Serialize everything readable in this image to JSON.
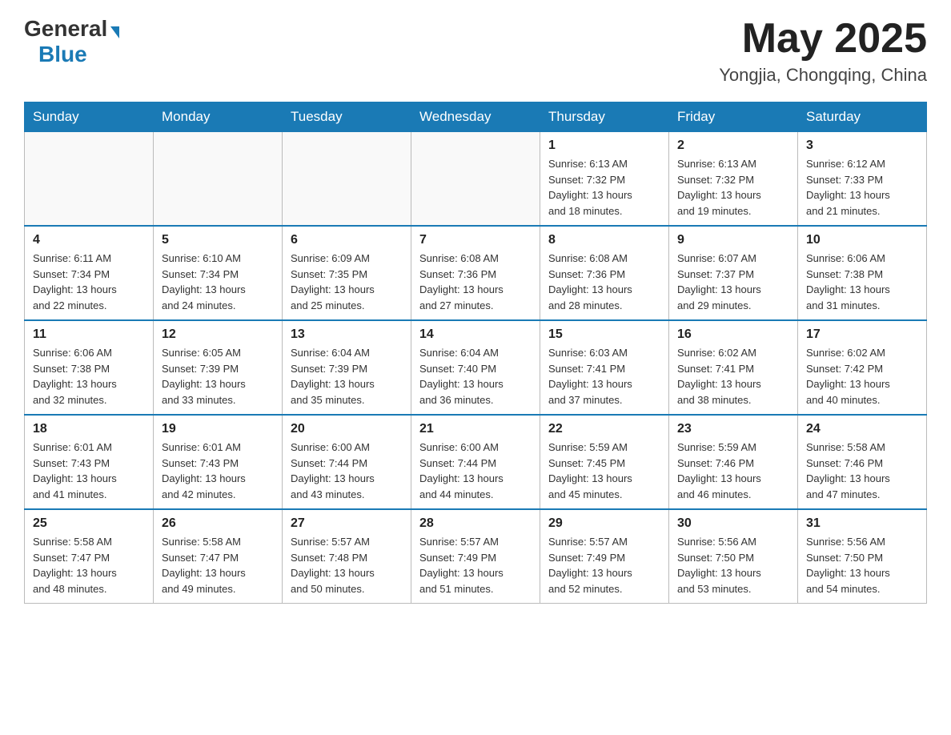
{
  "header": {
    "logo_general": "General",
    "logo_blue": "Blue",
    "month": "May 2025",
    "location": "Yongjia, Chongqing, China"
  },
  "days_of_week": [
    "Sunday",
    "Monday",
    "Tuesday",
    "Wednesday",
    "Thursday",
    "Friday",
    "Saturday"
  ],
  "weeks": [
    [
      {
        "day": "",
        "info": ""
      },
      {
        "day": "",
        "info": ""
      },
      {
        "day": "",
        "info": ""
      },
      {
        "day": "",
        "info": ""
      },
      {
        "day": "1",
        "info": "Sunrise: 6:13 AM\nSunset: 7:32 PM\nDaylight: 13 hours\nand 18 minutes."
      },
      {
        "day": "2",
        "info": "Sunrise: 6:13 AM\nSunset: 7:32 PM\nDaylight: 13 hours\nand 19 minutes."
      },
      {
        "day": "3",
        "info": "Sunrise: 6:12 AM\nSunset: 7:33 PM\nDaylight: 13 hours\nand 21 minutes."
      }
    ],
    [
      {
        "day": "4",
        "info": "Sunrise: 6:11 AM\nSunset: 7:34 PM\nDaylight: 13 hours\nand 22 minutes."
      },
      {
        "day": "5",
        "info": "Sunrise: 6:10 AM\nSunset: 7:34 PM\nDaylight: 13 hours\nand 24 minutes."
      },
      {
        "day": "6",
        "info": "Sunrise: 6:09 AM\nSunset: 7:35 PM\nDaylight: 13 hours\nand 25 minutes."
      },
      {
        "day": "7",
        "info": "Sunrise: 6:08 AM\nSunset: 7:36 PM\nDaylight: 13 hours\nand 27 minutes."
      },
      {
        "day": "8",
        "info": "Sunrise: 6:08 AM\nSunset: 7:36 PM\nDaylight: 13 hours\nand 28 minutes."
      },
      {
        "day": "9",
        "info": "Sunrise: 6:07 AM\nSunset: 7:37 PM\nDaylight: 13 hours\nand 29 minutes."
      },
      {
        "day": "10",
        "info": "Sunrise: 6:06 AM\nSunset: 7:38 PM\nDaylight: 13 hours\nand 31 minutes."
      }
    ],
    [
      {
        "day": "11",
        "info": "Sunrise: 6:06 AM\nSunset: 7:38 PM\nDaylight: 13 hours\nand 32 minutes."
      },
      {
        "day": "12",
        "info": "Sunrise: 6:05 AM\nSunset: 7:39 PM\nDaylight: 13 hours\nand 33 minutes."
      },
      {
        "day": "13",
        "info": "Sunrise: 6:04 AM\nSunset: 7:39 PM\nDaylight: 13 hours\nand 35 minutes."
      },
      {
        "day": "14",
        "info": "Sunrise: 6:04 AM\nSunset: 7:40 PM\nDaylight: 13 hours\nand 36 minutes."
      },
      {
        "day": "15",
        "info": "Sunrise: 6:03 AM\nSunset: 7:41 PM\nDaylight: 13 hours\nand 37 minutes."
      },
      {
        "day": "16",
        "info": "Sunrise: 6:02 AM\nSunset: 7:41 PM\nDaylight: 13 hours\nand 38 minutes."
      },
      {
        "day": "17",
        "info": "Sunrise: 6:02 AM\nSunset: 7:42 PM\nDaylight: 13 hours\nand 40 minutes."
      }
    ],
    [
      {
        "day": "18",
        "info": "Sunrise: 6:01 AM\nSunset: 7:43 PM\nDaylight: 13 hours\nand 41 minutes."
      },
      {
        "day": "19",
        "info": "Sunrise: 6:01 AM\nSunset: 7:43 PM\nDaylight: 13 hours\nand 42 minutes."
      },
      {
        "day": "20",
        "info": "Sunrise: 6:00 AM\nSunset: 7:44 PM\nDaylight: 13 hours\nand 43 minutes."
      },
      {
        "day": "21",
        "info": "Sunrise: 6:00 AM\nSunset: 7:44 PM\nDaylight: 13 hours\nand 44 minutes."
      },
      {
        "day": "22",
        "info": "Sunrise: 5:59 AM\nSunset: 7:45 PM\nDaylight: 13 hours\nand 45 minutes."
      },
      {
        "day": "23",
        "info": "Sunrise: 5:59 AM\nSunset: 7:46 PM\nDaylight: 13 hours\nand 46 minutes."
      },
      {
        "day": "24",
        "info": "Sunrise: 5:58 AM\nSunset: 7:46 PM\nDaylight: 13 hours\nand 47 minutes."
      }
    ],
    [
      {
        "day": "25",
        "info": "Sunrise: 5:58 AM\nSunset: 7:47 PM\nDaylight: 13 hours\nand 48 minutes."
      },
      {
        "day": "26",
        "info": "Sunrise: 5:58 AM\nSunset: 7:47 PM\nDaylight: 13 hours\nand 49 minutes."
      },
      {
        "day": "27",
        "info": "Sunrise: 5:57 AM\nSunset: 7:48 PM\nDaylight: 13 hours\nand 50 minutes."
      },
      {
        "day": "28",
        "info": "Sunrise: 5:57 AM\nSunset: 7:49 PM\nDaylight: 13 hours\nand 51 minutes."
      },
      {
        "day": "29",
        "info": "Sunrise: 5:57 AM\nSunset: 7:49 PM\nDaylight: 13 hours\nand 52 minutes."
      },
      {
        "day": "30",
        "info": "Sunrise: 5:56 AM\nSunset: 7:50 PM\nDaylight: 13 hours\nand 53 minutes."
      },
      {
        "day": "31",
        "info": "Sunrise: 5:56 AM\nSunset: 7:50 PM\nDaylight: 13 hours\nand 54 minutes."
      }
    ]
  ]
}
